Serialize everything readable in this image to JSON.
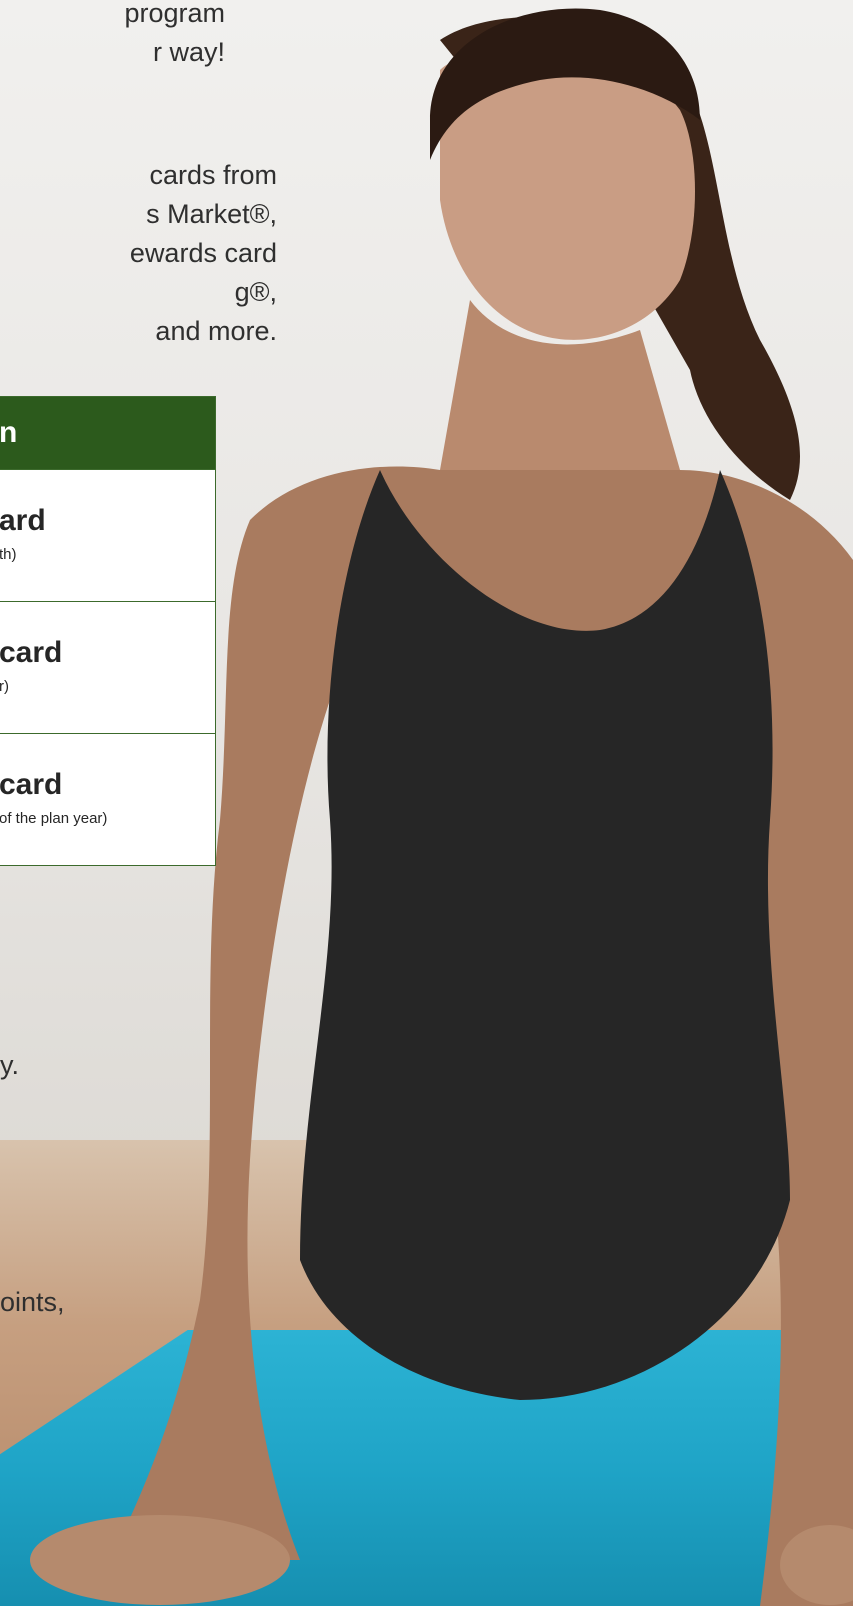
{
  "intro_lines": [
    "program",
    "r way!"
  ],
  "cards_lines": [
    "cards from",
    "s Market®,",
    "ewards card",
    "g®,",
    "and more."
  ],
  "table": {
    "header": "n",
    "rows": [
      {
        "title": "ard",
        "note": "th)"
      },
      {
        "title": "card",
        "note": "r)"
      },
      {
        "title": "card",
        "note": "of the plan year)"
      }
    ]
  },
  "lower_lines": [
    "y.",
    "oints,"
  ],
  "colors": {
    "table_header": "#2c5a1c",
    "table_border": "#3c6a2c",
    "mat": "#1fa4c7"
  }
}
